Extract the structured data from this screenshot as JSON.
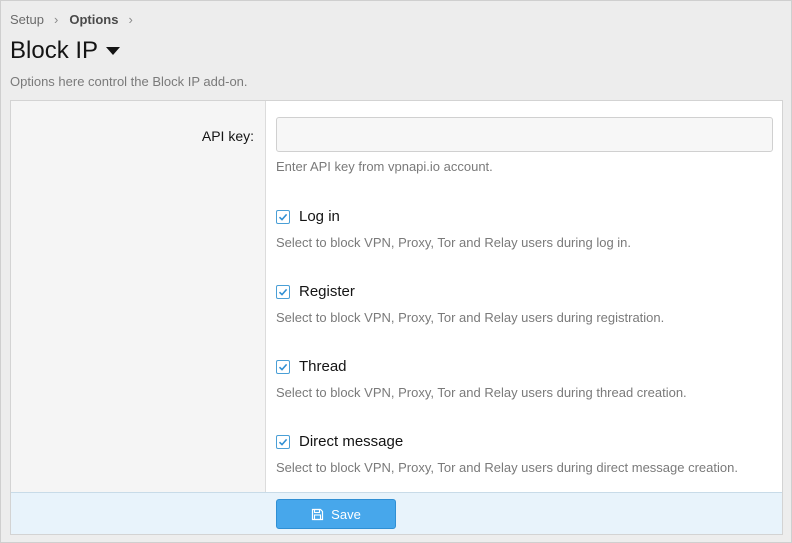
{
  "breadcrumb": {
    "items": [
      "Setup",
      "Options"
    ]
  },
  "page": {
    "title": "Block IP",
    "description": "Options here control the Block IP add-on."
  },
  "form": {
    "api_key": {
      "label": "API key:",
      "value": "",
      "hint": "Enter API key from vpnapi.io account."
    },
    "options": [
      {
        "label": "Log in",
        "checked": true,
        "hint": "Select to block VPN, Proxy, Tor and Relay users during log in."
      },
      {
        "label": "Register",
        "checked": true,
        "hint": "Select to block VPN, Proxy, Tor and Relay users during registration."
      },
      {
        "label": "Thread",
        "checked": true,
        "hint": "Select to block VPN, Proxy, Tor and Relay users during thread creation."
      },
      {
        "label": "Direct message",
        "checked": true,
        "hint": "Select to block VPN, Proxy, Tor and Relay users during direct message creation."
      }
    ]
  },
  "footer": {
    "save_label": "Save"
  },
  "icons": {
    "title_menu": "caret-down-icon",
    "save": "save-icon",
    "check": "check-icon"
  },
  "colors": {
    "accent": "#47a7eb",
    "checkbox_border": "#4a9fd6"
  }
}
